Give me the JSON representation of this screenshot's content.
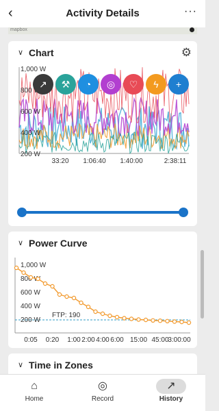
{
  "header": {
    "back_icon": "chevron-left-icon",
    "title": "Activity Details",
    "more_icon": "more-horizontal-icon"
  },
  "map": {
    "attribution": "mapbox"
  },
  "chart_card": {
    "title": "Chart",
    "settings_icon": "gear-icon",
    "y_ticks": [
      "1,000 W",
      "800 W",
      "600 W",
      "400 W",
      "200 W"
    ],
    "x_ticks": [
      "33:20",
      "1:06:40",
      "1:40:00",
      "2:38:11"
    ],
    "metric_buttons": [
      {
        "name": "trend-icon",
        "glyph": "↗",
        "color": "#3a3a3a"
      },
      {
        "name": "wrench-icon",
        "glyph": "⚒",
        "color": "#2aa39a"
      },
      {
        "name": "speed-icon",
        "glyph": "◔",
        "color": "#1f8fe0"
      },
      {
        "name": "cadence-icon",
        "glyph": "◎",
        "color": "#b23fd0"
      },
      {
        "name": "heart-icon",
        "glyph": "♡",
        "color": "#e84b56"
      },
      {
        "name": "power-icon",
        "glyph": "ϟ",
        "color": "#f39a1f"
      },
      {
        "name": "add-chart-icon",
        "glyph": "+",
        "color": "#1f7fd0"
      }
    ],
    "range_slider": {
      "start": 0,
      "end": 1
    }
  },
  "power_curve": {
    "title": "Power Curve",
    "ftp_label": "FTP: 190",
    "chart_data": {
      "type": "line",
      "x": [
        "0:01",
        "0:02",
        "0:05",
        "0:10",
        "0:15",
        "0:20",
        "0:30",
        "0:45",
        "1:00",
        "1:30",
        "2:00",
        "3:00",
        "4:00",
        "5:00",
        "6:00",
        "8:00",
        "10:00",
        "15:00",
        "20:00",
        "30:00",
        "45:00",
        "1:00:00",
        "1:30:00",
        "2:00:00",
        "2:38:00"
      ],
      "series": [
        {
          "values": [
            950,
            880,
            810,
            790,
            720,
            680,
            560,
            530,
            510,
            440,
            380,
            310,
            280,
            250,
            230,
            215,
            205,
            195,
            190,
            182,
            178,
            172,
            165,
            160,
            150
          ]
        }
      ],
      "y_ticks": [
        "1,000 W",
        "800 W",
        "600 W",
        "400 W",
        "200 W"
      ],
      "x_ticks": [
        "0:05",
        "0:20",
        "1:00",
        "2:00",
        "4:00",
        "6:00",
        "15:00",
        "45:00",
        "3:00:00"
      ],
      "ylim": [
        0,
        1100
      ],
      "ftp": 190,
      "line_color": "#f29a2e",
      "ftp_color": "#2f9bc4"
    }
  },
  "time_in_zones": {
    "title": "Time in Zones"
  },
  "bottom_nav": {
    "items": [
      {
        "label": "Home",
        "icon": "home-icon"
      },
      {
        "label": "Record",
        "icon": "record-icon"
      },
      {
        "label": "History",
        "icon": "history-icon"
      }
    ]
  }
}
